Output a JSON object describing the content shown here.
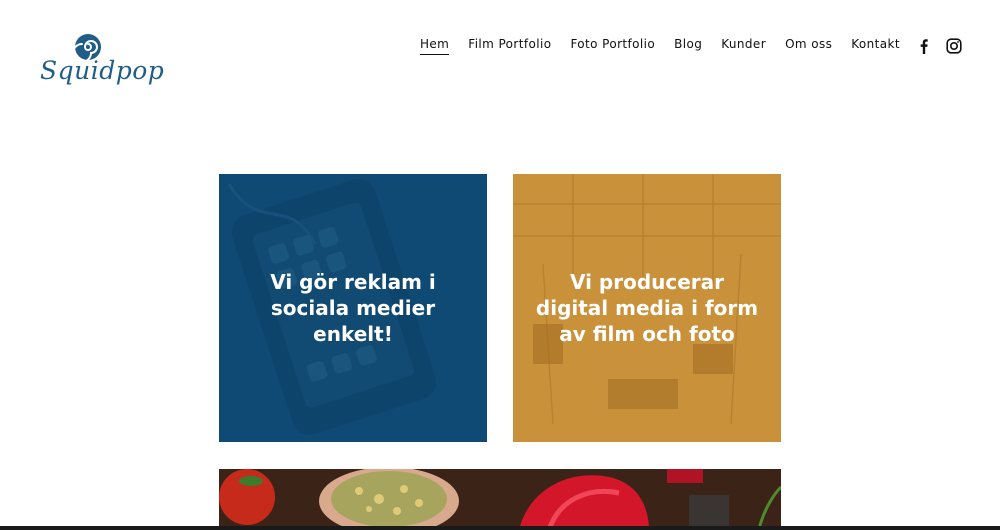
{
  "brand": {
    "name": "Squidpop",
    "color": "#1f5d86"
  },
  "nav": {
    "items": [
      {
        "label": "Hem",
        "active": true
      },
      {
        "label": "Film Portfolio",
        "active": false
      },
      {
        "label": "Foto Portfolio",
        "active": false
      },
      {
        "label": "Blog",
        "active": false
      },
      {
        "label": "Kunder",
        "active": false
      },
      {
        "label": "Om oss",
        "active": false
      },
      {
        "label": "Kontakt",
        "active": false
      }
    ]
  },
  "social": {
    "icons": [
      "facebook-icon",
      "instagram-icon"
    ]
  },
  "tiles": [
    {
      "text": "Vi gör reklam i sociala medier enkelt!",
      "color": "#0f4a74"
    },
    {
      "text": "Vi producerar digital media i form av film och foto",
      "color": "#c9913a"
    }
  ]
}
